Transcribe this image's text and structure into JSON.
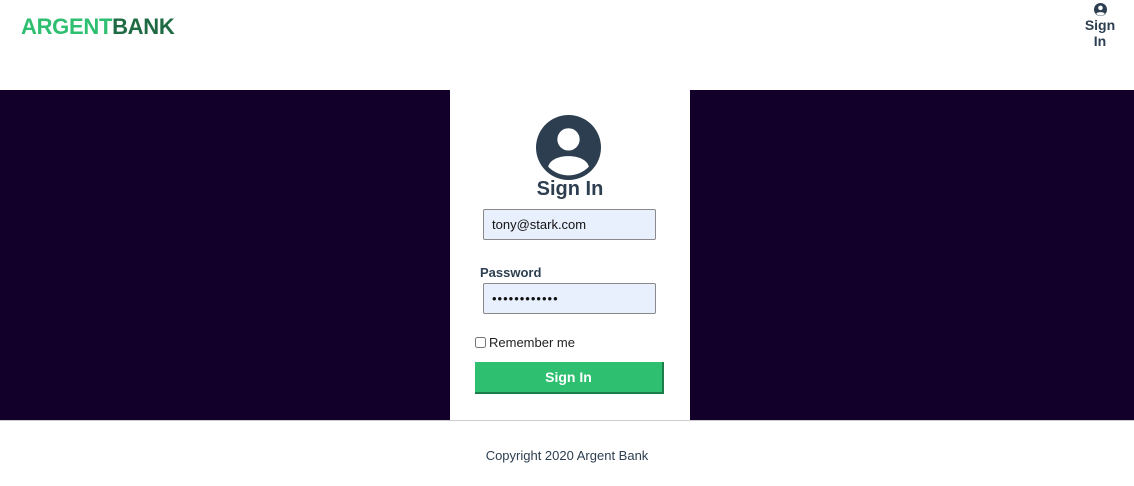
{
  "header": {
    "logo_part1": "ARGENT",
    "logo_part2": "BANK",
    "nav_signin_label": "Sign In",
    "nav_icon": "user-circle-icon"
  },
  "login": {
    "avatar_icon": "user-circle-icon",
    "title": "Sign In",
    "email_value": "tony@stark.com",
    "password_label": "Password",
    "password_value": "••••••••••••",
    "remember_label": "Remember me",
    "remember_checked": false,
    "submit_label": "Sign In"
  },
  "footer": {
    "copyright": "Copyright 2020 Argent Bank"
  },
  "colors": {
    "brand_green": "#2fbf71",
    "brand_dark_green": "#1e6b43",
    "hero_background": "#12002b",
    "text_dark": "#2c3e50"
  }
}
